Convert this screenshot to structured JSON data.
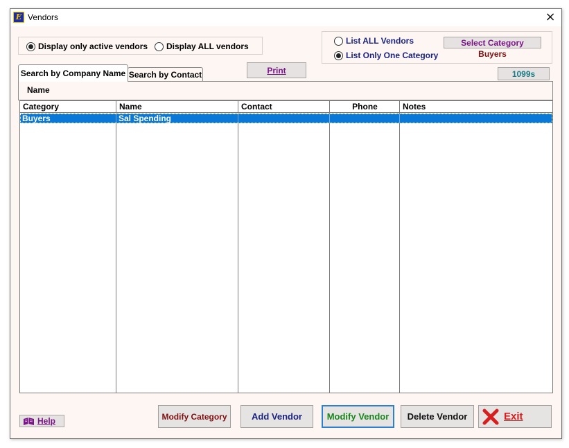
{
  "window": {
    "title": "Vendors",
    "close_glyph": "×"
  },
  "filter_active": {
    "active_label": "Display only active vendors",
    "all_label": "Display ALL vendors",
    "selected": "active"
  },
  "category_box": {
    "list_all_label": "List ALL Vendors",
    "list_one_label": "List Only One Category",
    "selected": "one",
    "select_button": "Select Category",
    "current_category": "Buyers"
  },
  "tabs": [
    {
      "label": "Search by Company Name",
      "active": true
    },
    {
      "label": "Search by Contact",
      "active": false
    }
  ],
  "print_button": "Print",
  "forms_button": "1099s",
  "search_field_label": "Name",
  "grid": {
    "columns": [
      "Category",
      "Name",
      "Contact",
      "Phone",
      "Notes"
    ],
    "rows": [
      {
        "category": "Buyers",
        "name": "Sal Spending",
        "contact": "",
        "phone": "",
        "notes": ""
      }
    ],
    "selected_row": 0
  },
  "footer": {
    "help": "Help",
    "modify_category": "Modify Category",
    "add_vendor": "Add Vendor",
    "modify_vendor": "Modify Vendor",
    "delete_vendor": "Delete Vendor",
    "exit": "Exit"
  },
  "colors": {
    "navy": "#1a237e",
    "purple": "#7a1587",
    "maroon": "#7f1010",
    "teal": "#1a7d86",
    "green": "#18861d",
    "red": "#d62020",
    "selection": "#0a78d7",
    "window_bg": "#fdf6f3"
  },
  "icons": {
    "app": "app-logo-icon",
    "help": "book-icon",
    "exit": "red-x-icon"
  }
}
